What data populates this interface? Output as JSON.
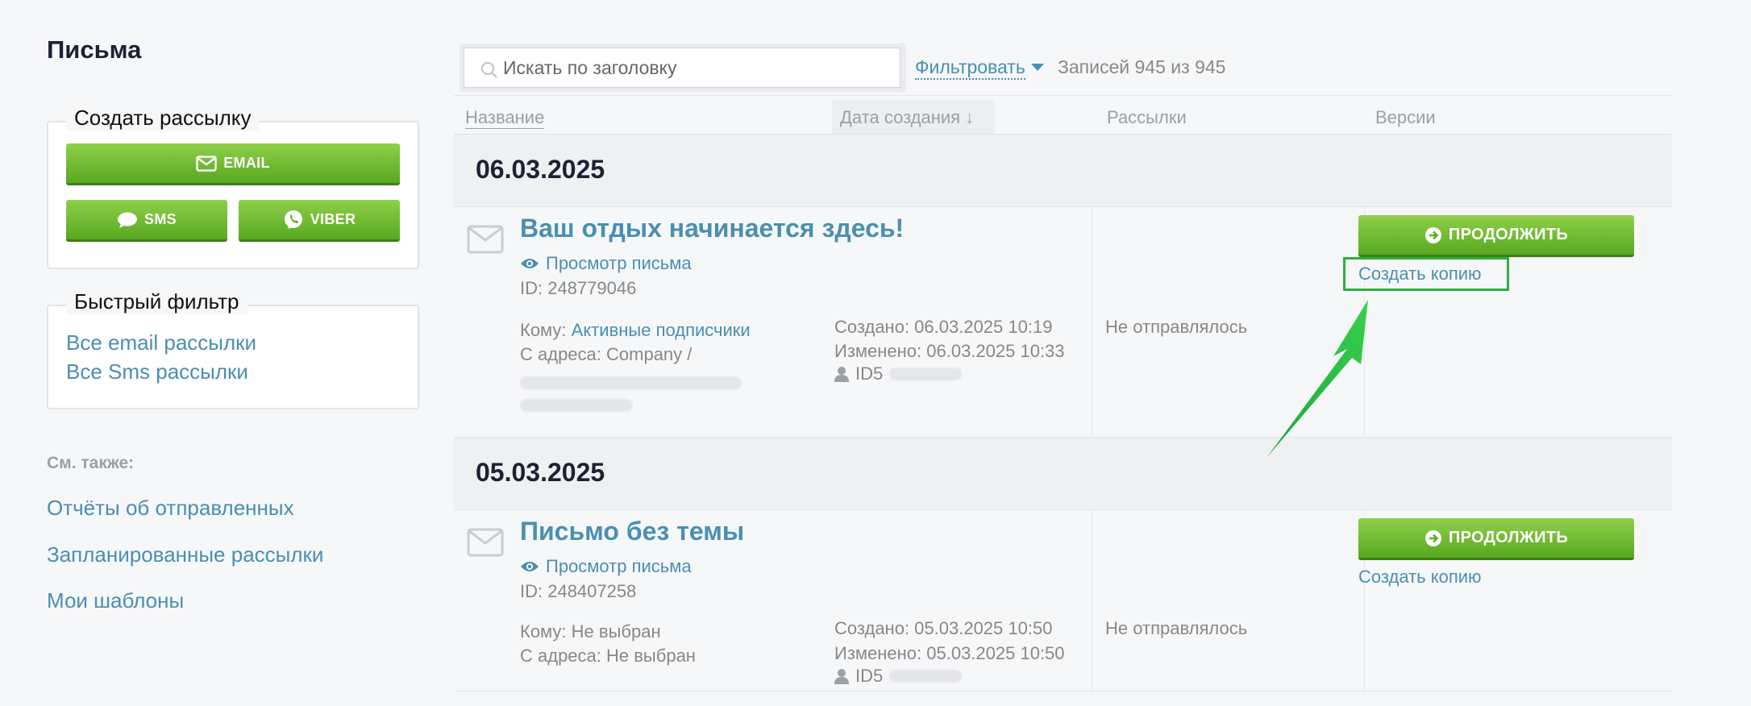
{
  "sidebar": {
    "title": "Письма",
    "create": {
      "legend": "Создать рассылку",
      "email_label": "EMAIL",
      "sms_label": "SMS",
      "viber_label": "VIBER"
    },
    "quick_filter": {
      "legend": "Быстрый фильтр",
      "items": [
        "Все email рассылки",
        "Все Sms рассылки"
      ]
    },
    "see_also": {
      "label": "См. также:",
      "links": [
        "Отчёты об отправленных",
        "Запланированные рассылки",
        "Мои шаблоны"
      ]
    }
  },
  "toolbar": {
    "search_placeholder": "Искать по заголовку",
    "filter_label": "Фильтровать",
    "records_text": "Записей 945 из 945"
  },
  "columns": [
    "Название",
    "Дата создания ↓",
    "Рассылки",
    "Версии"
  ],
  "groups": [
    {
      "date": "06.03.2025",
      "letter": {
        "subject": "Ваш отдых начинается здесь!",
        "view_label": "Просмотр письма",
        "id": "ID: 248779046",
        "to_label": "Кому:",
        "to_value": "Активные подписчики",
        "from_text": "С адреса: Company /",
        "created": "Создано: 06.03.2025 10:19",
        "modified": "Изменено: 06.03.2025 10:33",
        "author": "ID5",
        "status": "Не отправлялось",
        "continue_label": "ПРОДОЛЖИТЬ",
        "copy_label": "Создать копию"
      }
    },
    {
      "date": "05.03.2025",
      "letter": {
        "subject": "Письмо без темы",
        "view_label": "Просмотр письма",
        "id": "ID: 248407258",
        "to_label": "Кому:",
        "to_value": "Не выбран",
        "from_text": "С адреса: Не выбран",
        "created": "Создано: 05.03.2025 10:50",
        "modified": "Изменено: 05.03.2025 10:50",
        "author": "ID5",
        "status": "Не отправлялось",
        "continue_label": "ПРОДОЛЖИТЬ",
        "copy_label": "Создать копию"
      }
    }
  ],
  "colors": {
    "accent": "#4a8fb1",
    "button_green": "#6ab82e",
    "highlight": "#2fae3f"
  }
}
